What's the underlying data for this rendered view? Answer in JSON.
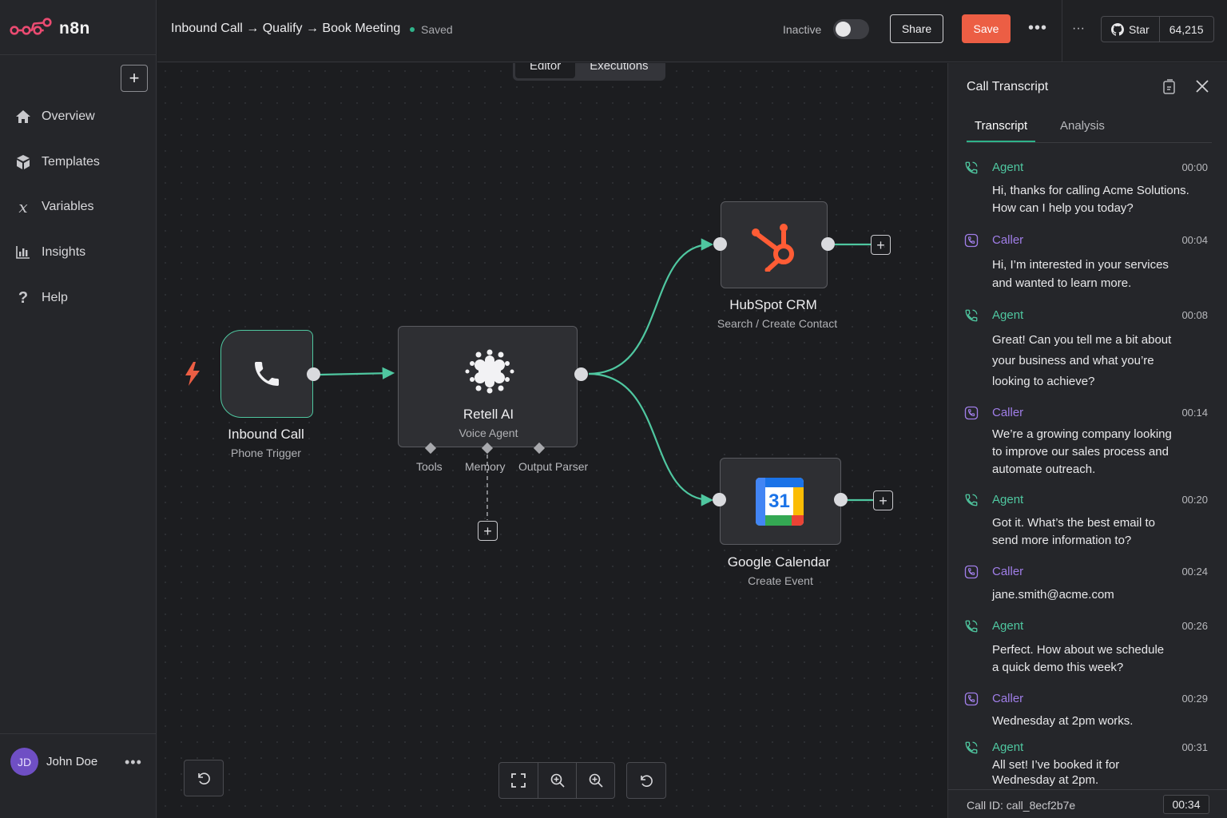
{
  "brand": {
    "name": "n8n"
  },
  "sidebar": {
    "items": [
      {
        "label": "Overview",
        "icon": "home-icon"
      },
      {
        "label": "Templates",
        "icon": "templates-icon"
      },
      {
        "label": "Variables",
        "icon": "variables-icon"
      },
      {
        "label": "Insights",
        "icon": "insights-icon"
      },
      {
        "label": "Help",
        "icon": "help-icon"
      }
    ],
    "user": {
      "initials": "JD",
      "name": "John Doe"
    }
  },
  "topbar": {
    "workflow_title": "Inbound Call → Qualify → Book Meeting",
    "saved_status": "Saved",
    "active_label": "Inactive",
    "active": false,
    "share_label": "Share",
    "save_label": "Save",
    "github": {
      "star_label": "Star",
      "count": "64,215"
    }
  },
  "canvas": {
    "tabs": [
      {
        "label": "Editor",
        "active": true
      },
      {
        "label": "Executions",
        "active": false
      }
    ],
    "nodes": {
      "trigger": {
        "title": "Inbound Call",
        "subtitle": "Phone Trigger"
      },
      "agent": {
        "title": "Retell AI",
        "subtitle": "Voice Agent",
        "sub_ports": [
          "Tools",
          "Memory",
          "Output Parser"
        ]
      },
      "crm": {
        "title": "HubSpot CRM",
        "subtitle": "Search / Create Contact"
      },
      "calendar": {
        "title": "Google Calendar",
        "subtitle": "Create Event",
        "icon_text": "31"
      }
    },
    "colors": {
      "accent": "#4fc7a0",
      "save": "#ec5e44",
      "hubspot": "#ff5c35",
      "trigger_bolt": "#ec5e44"
    }
  },
  "panel": {
    "title": "Call Transcript",
    "tabs": [
      {
        "label": "Transcript",
        "active": true
      },
      {
        "label": "Analysis",
        "active": false
      }
    ],
    "messages": [
      {
        "role": "Agent",
        "time": "00:00",
        "lines": [
          "Hi, thanks for calling Acme Solutions.",
          "How can I help you today?"
        ]
      },
      {
        "role": "Caller",
        "time": "00:04",
        "lines": [
          "Hi, I’m interested in your services",
          "and wanted to learn more."
        ]
      },
      {
        "role": "Agent",
        "time": "00:08",
        "lines": [
          "Great! Can you tell me a bit about",
          "your business and what you’re",
          "looking to achieve?"
        ]
      },
      {
        "role": "Caller",
        "time": "00:14",
        "lines": [
          "We’re a growing company looking",
          "to improve our sales process and",
          "automate outreach."
        ]
      },
      {
        "role": "Agent",
        "time": "00:20",
        "lines": [
          "Got it. What’s the best email to",
          "send more information to?"
        ]
      },
      {
        "role": "Caller",
        "time": "00:24",
        "lines": [
          "jane.smith@acme.com"
        ]
      },
      {
        "role": "Agent",
        "time": "00:26",
        "lines": [
          "Perfect. How about we schedule",
          "a quick demo this week?"
        ]
      },
      {
        "role": "Caller",
        "time": "00:29",
        "lines": [
          "Wednesday at 2pm works."
        ]
      },
      {
        "role": "Agent",
        "time": "00:31",
        "lines": [
          "All set! I’ve booked it for",
          "Wednesday at 2pm."
        ]
      }
    ],
    "call_id": "Call ID: call_8ecf2b7e",
    "duration": "00:34"
  }
}
